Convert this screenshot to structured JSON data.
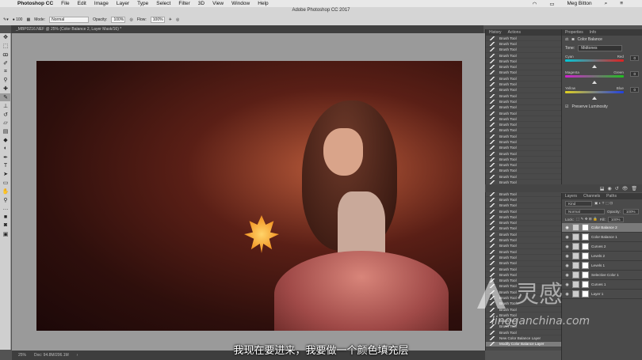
{
  "menubar": {
    "apple": "",
    "app_name": "Photoshop CC",
    "items": [
      "File",
      "Edit",
      "Image",
      "Layer",
      "Type",
      "Select",
      "Filter",
      "3D",
      "View",
      "Window",
      "Help"
    ],
    "user": "Meg Bitton"
  },
  "window_title": "Adobe Photoshop CC 2017",
  "options": {
    "brush_size": "100",
    "mode_label": "Mode:",
    "mode_value": "Normal",
    "opacity_label": "Opacity:",
    "opacity_value": "100%",
    "flow_label": "Flow:",
    "flow_value": "100%"
  },
  "document_tab": "_MBP0216.NEF @ 25% (Color Balance 2, Layer Mask/16) *",
  "status": {
    "zoom": "25%",
    "doc": "Doc: 94.8M/206.1M"
  },
  "history": {
    "tabs": [
      "History",
      "Actions"
    ],
    "items": [
      "Brush Tool",
      "Brush Tool",
      "Brush Tool",
      "Brush Tool",
      "Brush Tool",
      "Brush Tool",
      "Brush Tool",
      "Brush Tool",
      "Brush Tool",
      "Brush Tool",
      "Brush Tool",
      "Brush Tool",
      "Brush Tool",
      "Brush Tool",
      "Brush Tool",
      "Brush Tool",
      "Brush Tool",
      "Brush Tool",
      "Brush Tool",
      "Brush Tool",
      "Brush Tool",
      "Brush Tool",
      "Brush Tool",
      "Brush Tool",
      "Brush Tool",
      "Brush Tool",
      "Brush Tool",
      "Brush Tool",
      "Brush Tool",
      "Brush Tool",
      "Brush Tool",
      "Brush Tool",
      "Brush Tool",
      "Brush Tool",
      "Brush Tool",
      "Brush Tool",
      "Brush Tool",
      "Brush Tool",
      "Brush Tool",
      "Brush Tool",
      "Brush Tool",
      "Brush Tool",
      "Brush Tool",
      "Brush Tool",
      "Brush Tool",
      "Brush Tool",
      "Brush Tool",
      "Brush Tool",
      "Brush Tool",
      "Brush Tool",
      "Brush Tool",
      "Brush Tool",
      "New Color Balance Layer",
      "Modify Color Balance Layer"
    ]
  },
  "properties": {
    "tabs": [
      "Properties",
      "Info"
    ],
    "title": "Color Balance",
    "tone_label": "Tone:",
    "tone_value": "Midtones",
    "sliders": [
      {
        "left": "Cyan",
        "right": "Red",
        "value": "0",
        "fraction": 0.5,
        "gradient": "linear-gradient(90deg,#00c8d8,#e02020)"
      },
      {
        "left": "Magenta",
        "right": "Green",
        "value": "0",
        "fraction": 0.5,
        "gradient": "linear-gradient(90deg,#d020d0,#20c020)"
      },
      {
        "left": "Yellow",
        "right": "Blue",
        "value": "0",
        "fraction": 0.5,
        "gradient": "linear-gradient(90deg,#e0d020,#2040e0)"
      }
    ],
    "preserve_label": "Preserve Luminosity"
  },
  "layers": {
    "tabs": [
      "Layers",
      "Channels",
      "Paths"
    ],
    "kind_value": "Kind",
    "blend_value": "Normal",
    "opacity_label": "Opacity:",
    "opacity_value": "100%",
    "lock_label": "Lock:",
    "fill_label": "Fill:",
    "fill_value": "100%",
    "items": [
      {
        "name": "Color Balance 2",
        "selected": true
      },
      {
        "name": "Color Balance 1",
        "selected": false
      },
      {
        "name": "Curves 2",
        "selected": false
      },
      {
        "name": "Levels 2",
        "selected": false
      },
      {
        "name": "Levels 1",
        "selected": false
      },
      {
        "name": "Selective Color 1",
        "selected": false
      },
      {
        "name": "Curves 1",
        "selected": false
      },
      {
        "name": "Layer 1",
        "selected": false
      }
    ]
  },
  "subtitle": "我现在要进来，我要做一个颜色填充层",
  "watermark": {
    "brand": "灵感",
    "domain": "lingganchina.com"
  }
}
